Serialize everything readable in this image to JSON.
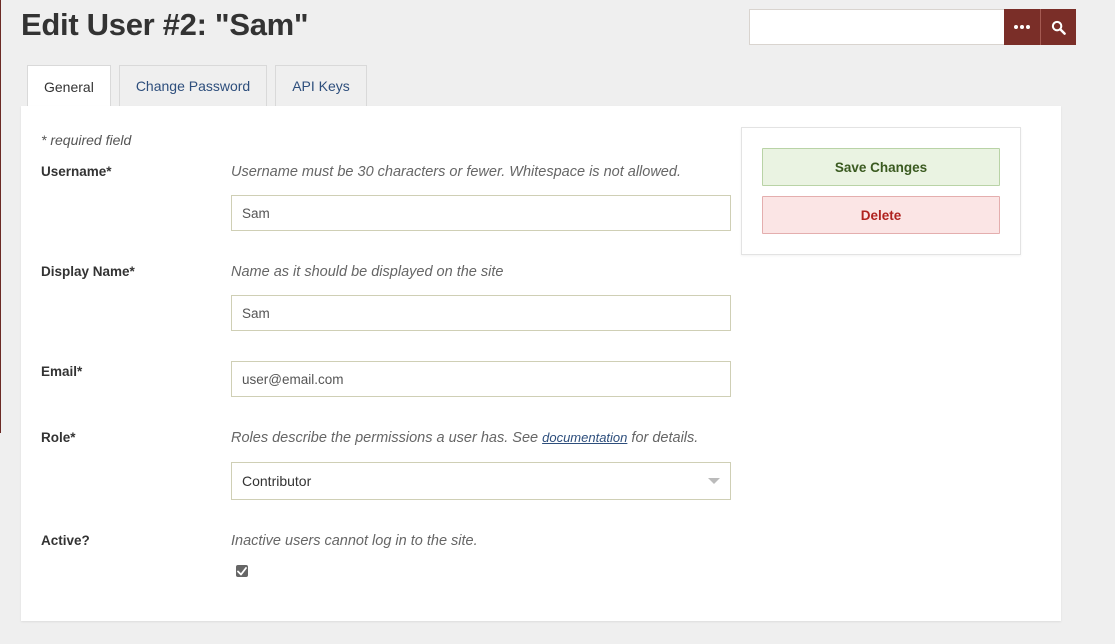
{
  "page": {
    "title": "Edit User #2: \"Sam\""
  },
  "search": {
    "value": ""
  },
  "tabs": [
    {
      "label": "General",
      "active": true
    },
    {
      "label": "Change Password",
      "active": false
    },
    {
      "label": "API Keys",
      "active": false
    }
  ],
  "form": {
    "required_note": "* required field",
    "username": {
      "label": "Username*",
      "help": "Username must be 30 characters or fewer. Whitespace is not allowed.",
      "value": "Sam"
    },
    "display_name": {
      "label": "Display Name*",
      "help": "Name as it should be displayed on the site",
      "value": "Sam"
    },
    "email": {
      "label": "Email*",
      "value": "user@email.com"
    },
    "role": {
      "label": "Role*",
      "help_before": "Roles describe the permissions a user has. See ",
      "help_link": "documentation",
      "help_after": " for details.",
      "value": "Contributor"
    },
    "active": {
      "label": "Active?",
      "help": "Inactive users cannot log in to the site.",
      "checked": true
    }
  },
  "actions": {
    "save_label": "Save Changes",
    "delete_label": "Delete"
  },
  "colors": {
    "brand": "#7a2e28",
    "background": "#efefef",
    "save_bg": "#eaf3e2",
    "delete_bg": "#fbe5e5",
    "link": "#2d4e7c"
  },
  "icons": {
    "more": "ellipsis-icon",
    "search": "search-icon",
    "check": "check-icon",
    "dropdown": "chevron-down-icon"
  }
}
